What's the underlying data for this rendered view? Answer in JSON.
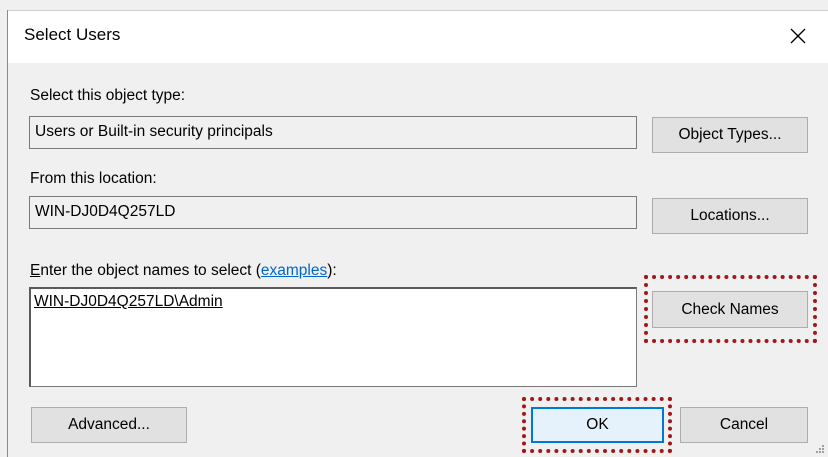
{
  "window": {
    "title": "Select Users",
    "close_glyph": "✕"
  },
  "object_type": {
    "label": "Select this object type:",
    "value": "Users or Built-in security principals",
    "button": "Object Types..."
  },
  "location": {
    "label": "From this location:",
    "value": "WIN-DJ0D4Q257LD",
    "button": "Locations..."
  },
  "names": {
    "label_mnemonic": "E",
    "label_rest": "nter the object names to select (",
    "link": "examples",
    "label_end": "):",
    "value": "WIN-DJ0D4Q257LD\\Admin",
    "check_button": "Check Names"
  },
  "footer": {
    "advanced_button": "Advanced...",
    "ok_button": "OK",
    "cancel_button": "Cancel"
  },
  "colors": {
    "highlight": "#a01818",
    "link": "#0066cc",
    "default_button_border": "#0078d7"
  }
}
